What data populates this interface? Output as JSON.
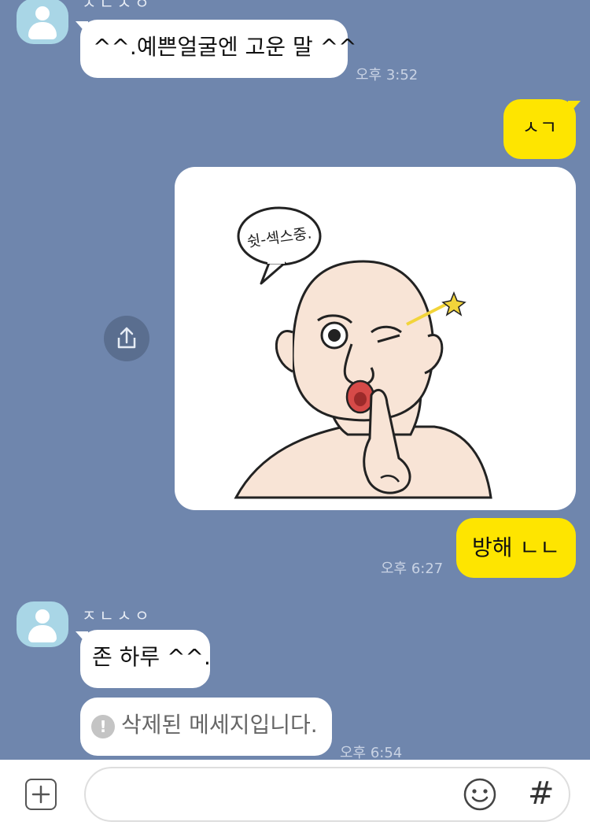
{
  "messages": [
    {
      "sender": "ㅈㄴㅅㅇ",
      "text": "^^.예쁜얼굴엔 고운 말 ^^",
      "time": "오후 3:52"
    },
    {
      "text": "ㅅㄱ"
    },
    {
      "text": "방해 ㄴㄴ",
      "time": "오후 6:27"
    },
    {
      "sender": "ㅈㄴㅅㅇ",
      "text": "존 하루 ^^."
    },
    {
      "text": "삭제된 메세지입니다.",
      "time": "오후 6:54",
      "deleted": true
    }
  ],
  "sticker": {
    "speech": "쉿-섹스중.",
    "icon": "winking-bald-man-sticker"
  },
  "icons": {
    "share": "share-icon",
    "plus": "plus-icon",
    "emoji": "emoji-icon",
    "hash": "hashtag-icon",
    "deleted": "exclamation-icon",
    "avatar": "default-avatar-icon"
  },
  "input": {
    "placeholder": "",
    "hash_label": "#"
  },
  "colors": {
    "background": "#6f86ad",
    "my_bubble": "#fee500",
    "other_bubble": "#ffffff"
  }
}
